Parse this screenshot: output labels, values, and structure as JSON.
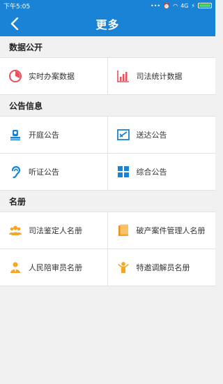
{
  "status_bar": {
    "time": "下午5:05",
    "signal": "4G"
  },
  "header": {
    "title": "更多"
  },
  "sections": [
    {
      "title": "数据公开",
      "items": [
        {
          "label": "实时办案数据",
          "icon": "pie-chart-icon"
        },
        {
          "label": "司法统计数据",
          "icon": "bar-chart-icon"
        }
      ]
    },
    {
      "title": "公告信息",
      "items": [
        {
          "label": "开庭公告",
          "icon": "court-icon"
        },
        {
          "label": "送达公告",
          "icon": "delivery-icon"
        },
        {
          "label": "听证公告",
          "icon": "ear-icon"
        },
        {
          "label": "综合公告",
          "icon": "grid-icon"
        }
      ]
    },
    {
      "title": "名册",
      "items": [
        {
          "label": "司法鉴定人名册",
          "icon": "group-icon"
        },
        {
          "label": "破产案件管理人名册",
          "icon": "book-icon"
        },
        {
          "label": "人民陪审员名册",
          "icon": "juror-icon"
        },
        {
          "label": "特邀调解员名册",
          "icon": "mediator-icon"
        }
      ]
    }
  ],
  "colors": {
    "primary": "#1a83d6",
    "red_icon": "#e8505b",
    "blue_icon": "#1a83d6",
    "orange_icon": "#f5a623"
  }
}
